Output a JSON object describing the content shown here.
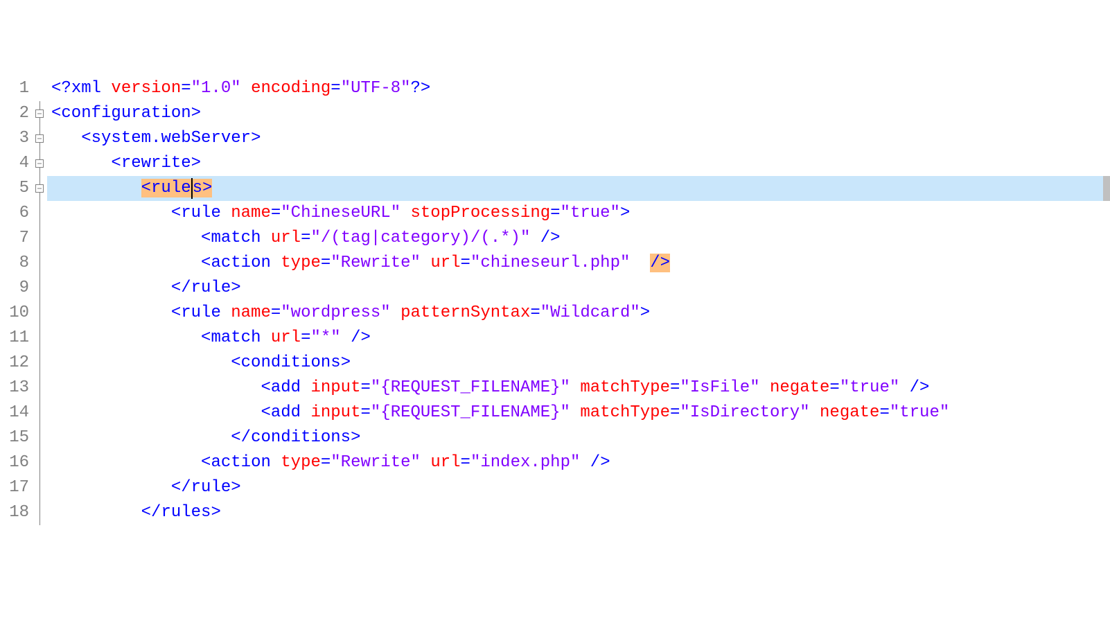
{
  "editor": {
    "line_count": 18,
    "highlighted_line": 5,
    "lines": {
      "1": {
        "indent": 0,
        "tokens": [
          [
            "bracket",
            "<?"
          ],
          [
            "elem",
            "xml "
          ],
          [
            "pi",
            "version"
          ],
          [
            "bracket",
            "="
          ],
          [
            "str",
            "\"1.0\""
          ],
          [
            "pi",
            " encoding"
          ],
          [
            "bracket",
            "="
          ],
          [
            "str",
            "\"UTF-8\""
          ],
          [
            "bracket",
            "?>"
          ]
        ]
      },
      "2": {
        "indent": 0,
        "fold": "box",
        "tokens": [
          [
            "bracket",
            "<"
          ],
          [
            "elem",
            "configuration"
          ],
          [
            "bracket",
            ">"
          ]
        ]
      },
      "3": {
        "indent": 1,
        "fold": "box",
        "tokens": [
          [
            "bracket",
            "<"
          ],
          [
            "elem",
            "system.webServer"
          ],
          [
            "bracket",
            ">"
          ]
        ]
      },
      "4": {
        "indent": 2,
        "fold": "box",
        "tokens": [
          [
            "bracket",
            "<"
          ],
          [
            "elem",
            "rewrite"
          ],
          [
            "bracket",
            ">"
          ]
        ]
      },
      "5": {
        "indent": 3,
        "fold": "box",
        "highlighted": true,
        "tokens": [
          [
            "hl-bracket",
            "<"
          ],
          [
            "hl-elem",
            "rule"
          ],
          [
            "caret",
            ""
          ],
          [
            "hl-elem",
            "s"
          ],
          [
            "hl-bracket",
            ">"
          ]
        ]
      },
      "6": {
        "indent": 4,
        "fold": "line",
        "tokens": [
          [
            "bracket",
            "<"
          ],
          [
            "elem",
            "rule "
          ],
          [
            "attr",
            "name"
          ],
          [
            "bracket",
            "="
          ],
          [
            "str",
            "\"ChineseURL\""
          ],
          [
            "elem",
            " "
          ],
          [
            "attr",
            "stopProcessing"
          ],
          [
            "bracket",
            "="
          ],
          [
            "str",
            "\"true\""
          ],
          [
            "bracket",
            ">"
          ]
        ]
      },
      "7": {
        "indent": 5,
        "fold": "line",
        "tokens": [
          [
            "bracket",
            "<"
          ],
          [
            "elem",
            "match "
          ],
          [
            "attr",
            "url"
          ],
          [
            "bracket",
            "="
          ],
          [
            "str",
            "\"/(tag|category)/(.*)\""
          ],
          [
            "bracket",
            " />"
          ]
        ]
      },
      "8": {
        "indent": 5,
        "fold": "line",
        "tokens": [
          [
            "bracket",
            "<"
          ],
          [
            "elem",
            "action "
          ],
          [
            "attr",
            "type"
          ],
          [
            "bracket",
            "="
          ],
          [
            "str",
            "\"Rewrite\""
          ],
          [
            "elem",
            " "
          ],
          [
            "attr",
            "url"
          ],
          [
            "bracket",
            "="
          ],
          [
            "str",
            "\"chineseurl.php\""
          ],
          [
            "text",
            "  "
          ],
          [
            "hl-bracket-close",
            "/>"
          ]
        ]
      },
      "9": {
        "indent": 4,
        "fold": "line",
        "tokens": [
          [
            "bracket",
            "</"
          ],
          [
            "elem",
            "rule"
          ],
          [
            "bracket",
            ">"
          ]
        ]
      },
      "10": {
        "indent": 4,
        "fold": "line",
        "tokens": [
          [
            "bracket",
            "<"
          ],
          [
            "elem",
            "rule "
          ],
          [
            "attr",
            "name"
          ],
          [
            "bracket",
            "="
          ],
          [
            "str",
            "\"wordpress\""
          ],
          [
            "elem",
            " "
          ],
          [
            "attr",
            "patternSyntax"
          ],
          [
            "bracket",
            "="
          ],
          [
            "str",
            "\"Wildcard\""
          ],
          [
            "bracket",
            ">"
          ]
        ]
      },
      "11": {
        "indent": 5,
        "fold": "line",
        "tokens": [
          [
            "bracket",
            "<"
          ],
          [
            "elem",
            "match "
          ],
          [
            "attr",
            "url"
          ],
          [
            "bracket",
            "="
          ],
          [
            "str",
            "\"*\""
          ],
          [
            "bracket",
            " />"
          ]
        ]
      },
      "12": {
        "indent": 6,
        "fold": "line",
        "tokens": [
          [
            "bracket",
            "<"
          ],
          [
            "elem",
            "conditions"
          ],
          [
            "bracket",
            ">"
          ]
        ]
      },
      "13": {
        "indent": 7,
        "fold": "line",
        "tokens": [
          [
            "bracket",
            "<"
          ],
          [
            "elem",
            "add "
          ],
          [
            "attr",
            "input"
          ],
          [
            "bracket",
            "="
          ],
          [
            "str",
            "\"{REQUEST_FILENAME}\""
          ],
          [
            "elem",
            " "
          ],
          [
            "attr",
            "matchType"
          ],
          [
            "bracket",
            "="
          ],
          [
            "str",
            "\"IsFile\""
          ],
          [
            "elem",
            " "
          ],
          [
            "attr",
            "negate"
          ],
          [
            "bracket",
            "="
          ],
          [
            "str",
            "\"true\""
          ],
          [
            "bracket",
            " />"
          ]
        ]
      },
      "14": {
        "indent": 7,
        "fold": "line",
        "tokens": [
          [
            "bracket",
            "<"
          ],
          [
            "elem",
            "add "
          ],
          [
            "attr",
            "input"
          ],
          [
            "bracket",
            "="
          ],
          [
            "str",
            "\"{REQUEST_FILENAME}\""
          ],
          [
            "elem",
            " "
          ],
          [
            "attr",
            "matchType"
          ],
          [
            "bracket",
            "="
          ],
          [
            "str",
            "\"IsDirectory\""
          ],
          [
            "elem",
            " "
          ],
          [
            "attr",
            "negate"
          ],
          [
            "bracket",
            "="
          ],
          [
            "str",
            "\"true\""
          ]
        ]
      },
      "15": {
        "indent": 6,
        "fold": "line",
        "tokens": [
          [
            "bracket",
            "</"
          ],
          [
            "elem",
            "conditions"
          ],
          [
            "bracket",
            ">"
          ]
        ]
      },
      "16": {
        "indent": 5,
        "fold": "line",
        "tokens": [
          [
            "bracket",
            "<"
          ],
          [
            "elem",
            "action "
          ],
          [
            "attr",
            "type"
          ],
          [
            "bracket",
            "="
          ],
          [
            "str",
            "\"Rewrite\""
          ],
          [
            "elem",
            " "
          ],
          [
            "attr",
            "url"
          ],
          [
            "bracket",
            "="
          ],
          [
            "str",
            "\"index.php\""
          ],
          [
            "bracket",
            " />"
          ]
        ]
      },
      "17": {
        "indent": 4,
        "fold": "line",
        "tokens": [
          [
            "bracket",
            "</"
          ],
          [
            "elem",
            "rule"
          ],
          [
            "bracket",
            ">"
          ]
        ]
      },
      "18": {
        "indent": 3,
        "fold": "line",
        "tokens": [
          [
            "bracket",
            "</"
          ],
          [
            "elem",
            "rules"
          ],
          [
            "bracket",
            ">"
          ]
        ]
      }
    },
    "indent_unit": "   "
  }
}
